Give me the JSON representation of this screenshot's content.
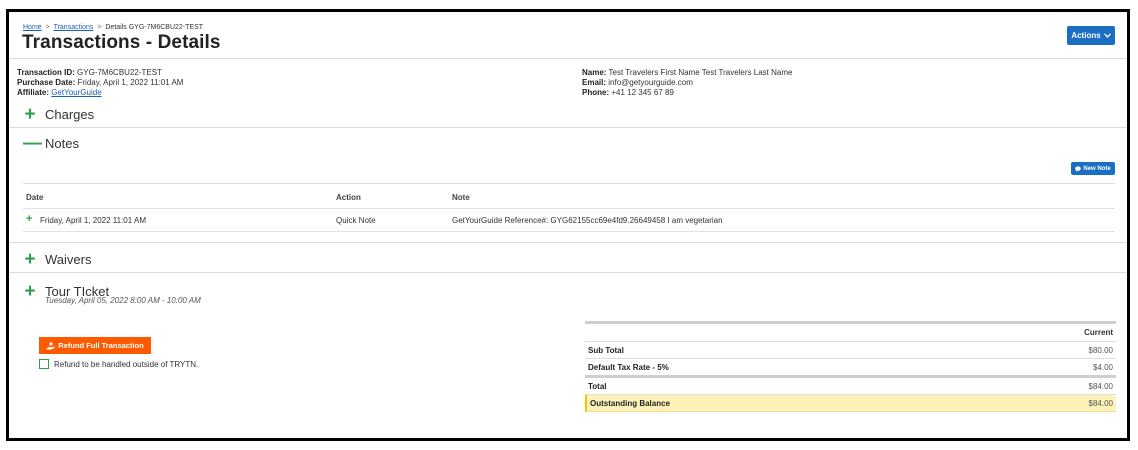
{
  "breadcrumb": {
    "home": "Home",
    "sep1": ">",
    "transactions": "Transactions",
    "sep2": ">",
    "current": "Details GYG-7M6CBU22-TEST"
  },
  "page_title": "Transactions - Details",
  "actions_label": "Actions",
  "info": {
    "transaction_id_label": "Transaction ID:",
    "transaction_id": "GYG-7M6CBU22-TEST",
    "purchase_date_label": "Purchase Date:",
    "purchase_date": "Friday, April 1, 2022 11:01 AM",
    "affiliate_label": "Affiliate:",
    "affiliate": "GetYourGuide",
    "name_label": "Name:",
    "name": "Test Travelers First Name Test Travelers Last Name",
    "email_label": "Email:",
    "email": "info@getyourguide.com",
    "phone_label": "Phone:",
    "phone": "+41 12 345 67 89"
  },
  "sections": {
    "charges": {
      "icon": "+",
      "title": "Charges"
    },
    "notes": {
      "icon": "—",
      "title": "Notes"
    },
    "waivers": {
      "icon": "+",
      "title": "Waivers"
    },
    "tour": {
      "icon": "+",
      "title": "Tour TIcket",
      "subtitle": "Tuesday, April 05, 2022 8:00 AM - 10:00 AM"
    }
  },
  "new_note_label": "New Note",
  "notes_table": {
    "headers": {
      "date": "Date",
      "action": "Action",
      "note": "Note"
    },
    "rows": [
      {
        "expand": "+",
        "date": "Friday, April 1, 2022 11:01 AM",
        "action": "Quick Note",
        "note": "GetYourGuide Reference#: GYG62155cc69e4fd9.26649458 I am vegetarian"
      }
    ]
  },
  "refund": {
    "button_label": "Refund Full Transaction",
    "checkbox_label": "Refund to be handled outside of TRYTN."
  },
  "totals": {
    "header": "Current",
    "sub_total_label": "Sub Total",
    "sub_total": "$80.00",
    "tax_label": "Default Tax Rate - 5%",
    "tax": "$4.00",
    "total_label": "Total",
    "total": "$84.00",
    "outstanding_label": "Outstanding Balance",
    "outstanding": "$84.00"
  },
  "colors": {
    "primary_blue": "#1a6fc4",
    "plus_green": "#2e9f4a",
    "refund_orange": "#ff5a00",
    "highlight_yellow": "#fdf2b8"
  }
}
